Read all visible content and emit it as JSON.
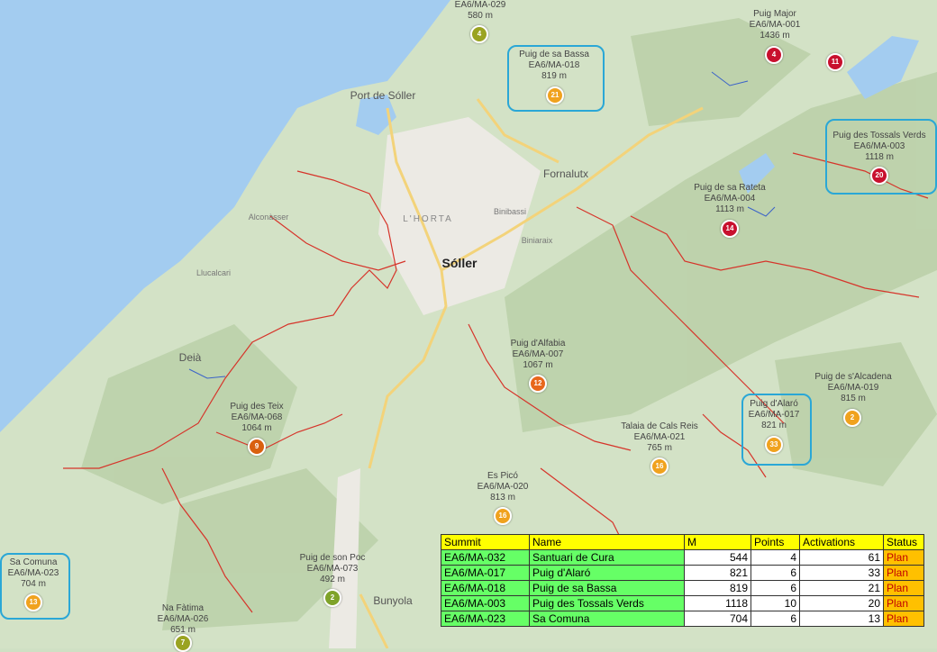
{
  "places": {
    "port_soller": "Port de Sóller",
    "soller": "Sóller",
    "fornalutx": "Fornalutx",
    "lhorta": "L'HORTA",
    "binibassi": "Binibassi",
    "biniaraix": "Biniaraix",
    "alconasser": "Alconàsser",
    "llucalcari": "Llucalcari",
    "deia": "Deià",
    "bunyola": "Bunyola"
  },
  "summits": [
    {
      "id": "s4",
      "name": "",
      "code": "EA6/MA-029",
      "height": "580 m",
      "value": "4",
      "color": "#9aa321"
    },
    {
      "id": "s21",
      "name": "Puig de sa Bassa",
      "code": "EA6/MA-018",
      "height": "819 m",
      "value": "21",
      "color": "#f0a21e"
    },
    {
      "id": "s4b",
      "name": "Puig Major",
      "code": "EA6/MA-001",
      "height": "1436 m",
      "value": "4",
      "color": "#c8102e"
    },
    {
      "id": "s11",
      "name": "",
      "code": "",
      "height": "",
      "value": "11",
      "color": "#c8102e"
    },
    {
      "id": "s20",
      "name": "Puig des Tossals Verds",
      "code": "EA6/MA-003",
      "height": "1118 m",
      "value": "20",
      "color": "#c8102e"
    },
    {
      "id": "s14",
      "name": "Puig de sa Rateta",
      "code": "EA6/MA-004",
      "height": "1113 m",
      "value": "14",
      "color": "#c8102e"
    },
    {
      "id": "s12",
      "name": "Puig d'Alfabia",
      "code": "EA6/MA-007",
      "height": "1067 m",
      "value": "12",
      "color": "#e8671c"
    },
    {
      "id": "s2",
      "name": "Puig de s'Alcadena",
      "code": "EA6/MA-019",
      "height": "815 m",
      "value": "2",
      "color": "#f0a21e"
    },
    {
      "id": "s33",
      "name": "Puig d'Alaró",
      "code": "EA6/MA-017",
      "height": "821 m",
      "value": "33",
      "color": "#f0a21e"
    },
    {
      "id": "s16",
      "name": "Talaia de Cals Reis",
      "code": "EA6/MA-021",
      "height": "765 m",
      "value": "16",
      "color": "#f0a21e"
    },
    {
      "id": "s9",
      "name": "Puig des Teix",
      "code": "EA6/MA-068",
      "height": "1064 m",
      "value": "9",
      "color": "#d9600f"
    },
    {
      "id": "s16b",
      "name": "Es Picó",
      "code": "EA6/MA-020",
      "height": "813 m",
      "value": "16",
      "color": "#f0a21e"
    },
    {
      "id": "s13",
      "name": "Sa Comuna",
      "code": "EA6/MA-023",
      "height": "704 m",
      "value": "13",
      "color": "#f0a21e"
    },
    {
      "id": "s2b",
      "name": "Puig de son Poc",
      "code": "EA6/MA-073",
      "height": "492 m",
      "value": "2",
      "color": "#7fa32a"
    },
    {
      "id": "s7",
      "name": "Na Fàtima",
      "code": "EA6/MA-026",
      "height": "651 m",
      "value": "7",
      "color": "#9aa321"
    }
  ],
  "table": {
    "headers": [
      "Summit",
      "Name",
      "M",
      "Points",
      "Activations",
      "Status"
    ],
    "rows": [
      [
        "EA6/MA-032",
        "Santuari de Cura",
        "544",
        "4",
        "61",
        "Plan"
      ],
      [
        "EA6/MA-017",
        "Puig d'Alaró",
        "821",
        "6",
        "33",
        "Plan"
      ],
      [
        "EA6/MA-018",
        "Puig de sa Bassa",
        "819",
        "6",
        "21",
        "Plan"
      ],
      [
        "EA6/MA-003",
        "Puig des Tossals Verds",
        "1118",
        "10",
        "20",
        "Plan"
      ],
      [
        "EA6/MA-023",
        "Sa Comuna",
        "704",
        "6",
        "13",
        "Plan"
      ]
    ]
  },
  "colors": {
    "sea": "#a3ccf0",
    "land": "#d3e2c6",
    "route": "#d6342a",
    "highlight": "#2aa7d6"
  }
}
